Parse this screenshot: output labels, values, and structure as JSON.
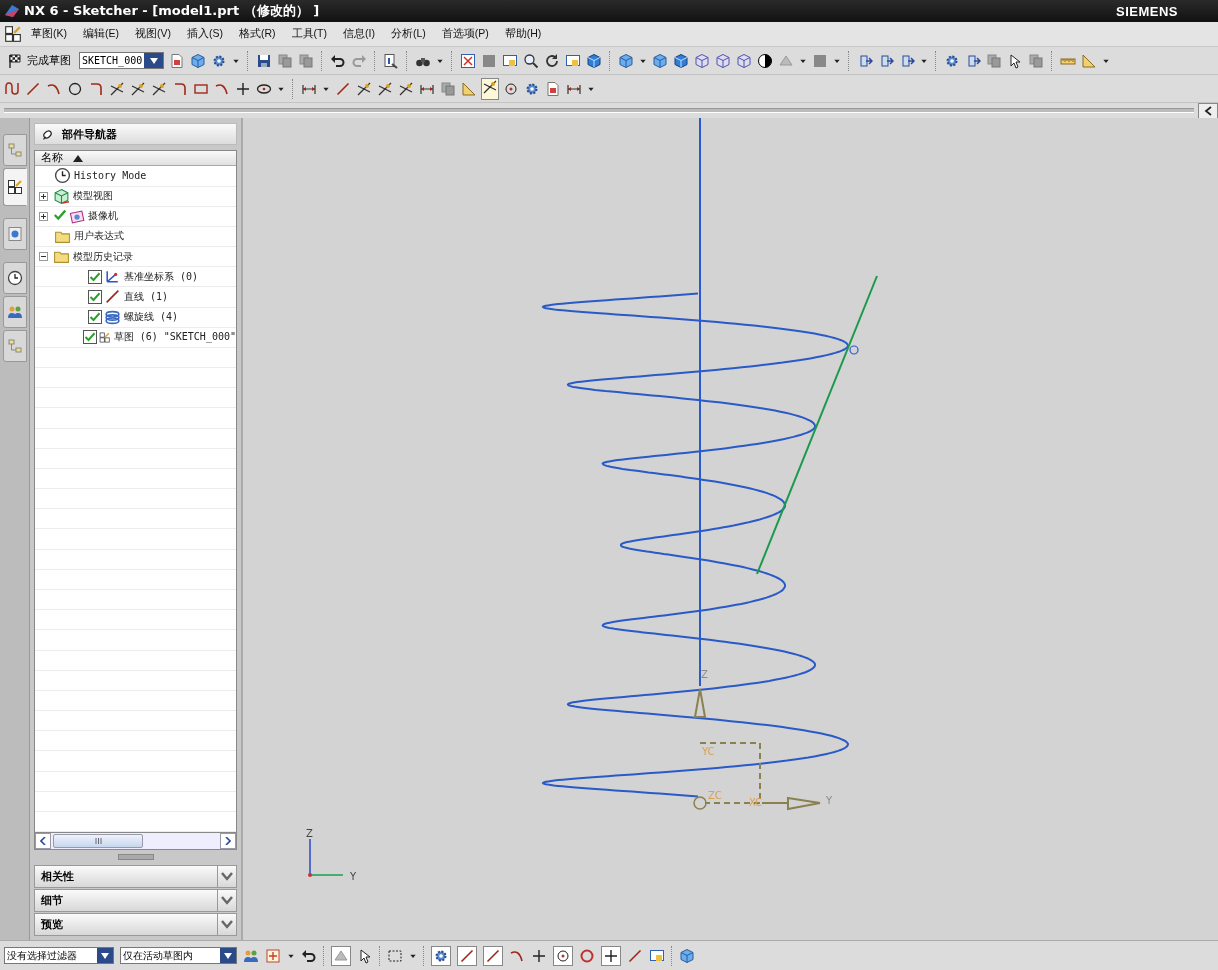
{
  "window": {
    "title": "NX 6 - Sketcher - [model1.prt （修改的） ]",
    "brand": "SIEMENS"
  },
  "menu": [
    "草图(K)",
    "编辑(E)",
    "视图(V)",
    "插入(S)",
    "格式(R)",
    "工具(T)",
    "信息(I)",
    "分析(L)",
    "首选项(P)",
    "帮助(H)"
  ],
  "sketch_toolbar": {
    "finish_label": "完成草图",
    "sketch_name": "SKETCH_000"
  },
  "resource_tabs": [
    {
      "selected": false
    },
    {
      "selected": true
    },
    {
      "selected": false
    },
    {
      "selected": false
    },
    {
      "selected": false
    },
    {
      "selected": false
    }
  ],
  "navigator": {
    "title": "部件导航器",
    "column": "名称",
    "tree": [
      {
        "label": "History Mode",
        "kind": "history",
        "checked": false
      },
      {
        "label": "模型视图",
        "kind": "views",
        "checked": false,
        "expanded": false
      },
      {
        "label": "摄像机",
        "kind": "camera",
        "checked": true,
        "expanded": false
      },
      {
        "label": "用户表达式",
        "kind": "folder",
        "checked": false
      },
      {
        "label": "模型历史记录",
        "kind": "folder",
        "checked": false,
        "expanded": true,
        "children": [
          {
            "label": "基准坐标系 (0)",
            "kind": "csys",
            "checked": true
          },
          {
            "label": "直线 (1)",
            "kind": "line",
            "checked": true
          },
          {
            "label": "螺旋线 (4)",
            "kind": "helix",
            "checked": true
          },
          {
            "label": "草图 (6) \"SKETCH_000\"",
            "kind": "sketch",
            "checked": true
          }
        ]
      }
    ]
  },
  "panels": [
    {
      "label": "相关性",
      "expanded": false
    },
    {
      "label": "细节",
      "expanded": false
    },
    {
      "label": "预览",
      "expanded": false
    }
  ],
  "viewport": {
    "axis_labels": {
      "z": "Z",
      "yc": "YC",
      "zc": "ZC",
      "xc": "XC",
      "y": "Y"
    },
    "triad_labels": {
      "z": "Z",
      "y": "Y"
    }
  },
  "status_bar": {
    "filter": "没有选择过滤器",
    "scope": "仅在活动草图内"
  }
}
